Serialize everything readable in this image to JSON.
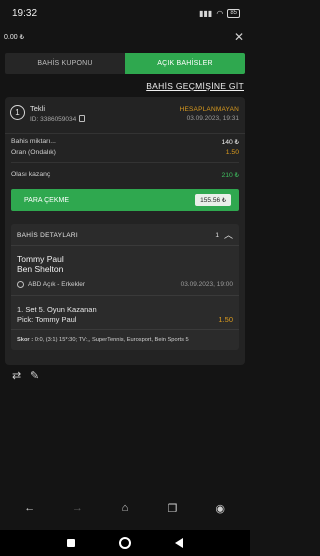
{
  "status_bar": {
    "time": "19:32",
    "battery": "85"
  },
  "topbar": {
    "balance": "0.00 ₺"
  },
  "tabs": [
    {
      "label": "BAHİS KUPONU",
      "active": false
    },
    {
      "label": "AÇIK BAHİSLER",
      "active": true
    }
  ],
  "history_link": "BAHİS GEÇMİŞİNE GİT",
  "bet": {
    "number": "1",
    "type": "Tekli",
    "id": "ID: 3386059034",
    "status": "HESAPLANMAYAN",
    "date": "03.09.2023, 19:31",
    "stake_label": "Bahis miktarı...",
    "stake_value": "140 ₺",
    "odds_label": "Oran (Ondalık)",
    "odds_value": "1.50",
    "potential_label": "Olası kazanç",
    "potential_value": "210 ₺",
    "cashout_label": "PARA ÇEKME",
    "cashout_value": "155.56 ₺",
    "details": {
      "heading": "BAHİS DETAYLARI",
      "count": "1",
      "team1": "Tommy Paul",
      "team2": "Ben Shelton",
      "league": "ABD Açık - Erkekler",
      "match_date": "03.09.2023, 19:00",
      "market": "1. Set 5. Oyun Kazanan",
      "pick": "Pick: Tommy Paul",
      "pick_odd": "1.50",
      "score_label": "Skor :",
      "score": "0:0, (3:1) 15*:30; TV:,, SuperTennis, Eurosport, Bein Sports 5"
    }
  },
  "colors": {
    "accent": "#2fa84f",
    "warning": "#d99a1e",
    "positive": "#3fbf5f"
  },
  "icons": [
    "wifi-icon",
    "signal-icon",
    "close-icon",
    "copy-icon",
    "chevron-up-icon",
    "tennis-ball-icon",
    "repeat-icon",
    "edit-icon",
    "back-arrow-icon",
    "forward-arrow-icon",
    "home-icon",
    "tabs-icon",
    "profile-icon"
  ]
}
